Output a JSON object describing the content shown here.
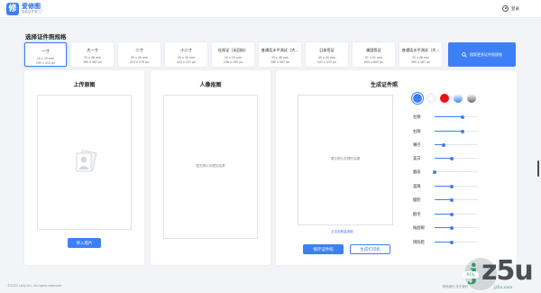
{
  "app": {
    "name": "爱修图",
    "subtitle": "智能证件照工厂",
    "logo_glyph": "修"
  },
  "user": {
    "login_label": "登录"
  },
  "section_title": "选择证件照规格",
  "specs": [
    {
      "name": "一寸",
      "size": "25 x 35 mm",
      "px": "295 x 413 px",
      "selected": true
    },
    {
      "name": "大一寸",
      "size": "33 x 48 mm",
      "px": "390 x 567 px"
    },
    {
      "name": "二寸",
      "size": "35 x 49 mm",
      "px": "413 x 579 px"
    },
    {
      "name": "小二寸",
      "size": "35 x 45 mm",
      "px": "413 x 531 px"
    },
    {
      "name": "社保证（无回执）",
      "size": "20 x 25 mm",
      "px": "236 x 295 px"
    },
    {
      "name": "普通话水平测试（大...",
      "size": "33 x 48 mm",
      "px": "390 x 567 px"
    },
    {
      "name": "日本签证",
      "size": "45 x 45 mm",
      "px": "531 x 531 px"
    },
    {
      "name": "美国签证",
      "size": "51 x 51 mm",
      "px": "600 x 600 px"
    },
    {
      "name": "普通话水平测试（大...",
      "size": "33 x 48 mm",
      "px": "390 x 567 px"
    }
  ],
  "search_more_label": "搜索更多证件照规格",
  "upload_panel": {
    "title": "上传原图",
    "button": "导入照片"
  },
  "cutout_panel": {
    "title": "人像抠图",
    "placeholder": "暂无照片处理的结果"
  },
  "generate_panel": {
    "title": "生成证件照",
    "placeholder": "暂无照片处理的结果",
    "link": "点击查看高清图",
    "save_button": "保存证件照",
    "print_button": "生成打印机"
  },
  "background_colors": [
    {
      "name": "blue",
      "color": "#3d7ff7",
      "selected": true
    },
    {
      "name": "white",
      "color": "#ffffff"
    },
    {
      "name": "red",
      "color": "#ee1111"
    },
    {
      "name": "blue-gradient",
      "color": "#8fb3f5"
    },
    {
      "name": "gray-gradient",
      "color": "#9a9a9a"
    }
  ],
  "adjustments": [
    {
      "label": "左眼",
      "value": 0.65
    },
    {
      "label": "右眼",
      "value": 0.65
    },
    {
      "label": "嘴巴",
      "value": 0.2
    },
    {
      "label": "美白",
      "value": 0.4
    },
    {
      "label": "磨皮",
      "value": 0.0
    },
    {
      "label": "美眼",
      "value": 0.4
    },
    {
      "label": "瘦脸",
      "value": 0.4
    },
    {
      "label": "鹅毛",
      "value": 0.4
    },
    {
      "label": "陆面眼",
      "value": 0.4
    },
    {
      "label": "阴阳脸",
      "value": 0.4
    }
  ],
  "footer": {
    "copyright": "©2021 Lexy Inc. All rights reserved",
    "right": "联系我们  关于我们"
  },
  "watermark": {
    "badge": "91%",
    "brand_j": "j",
    "brand_rest": "z5u",
    "url": "jz5u.com"
  },
  "accent_color": "#3d7ff7"
}
